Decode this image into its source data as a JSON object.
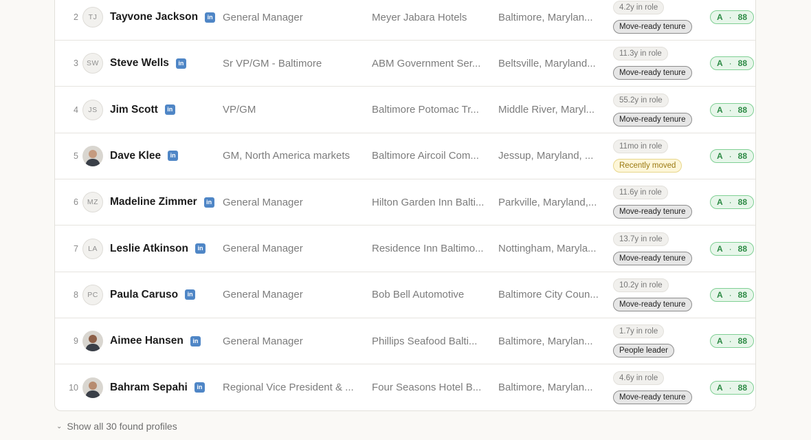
{
  "colors": {
    "linkedin": "#4f86c6",
    "score_green": "#2d8a45",
    "warn_amber": "#9b7a12"
  },
  "rows": [
    {
      "rank": "2",
      "initials": "TJ",
      "photo": false,
      "name": "Tayvone Jackson",
      "title": "General Manager",
      "company": "Meyer Jabara Hotels",
      "location": "Baltimore, Marylan...",
      "tenure": "4.2y in role",
      "status": "Move-ready tenure",
      "status_kind": "neutral",
      "grade": "A",
      "score": "88"
    },
    {
      "rank": "3",
      "initials": "SW",
      "photo": false,
      "name": "Steve Wells",
      "title": "Sr VP/GM - Baltimore",
      "company": "ABM Government Ser...",
      "location": "Beltsville, Maryland...",
      "tenure": "11.3y in role",
      "status": "Move-ready tenure",
      "status_kind": "neutral",
      "grade": "A",
      "score": "88"
    },
    {
      "rank": "4",
      "initials": "JS",
      "photo": false,
      "name": "Jim Scott",
      "title": "VP/GM",
      "company": "Baltimore Potomac Tr...",
      "location": "Middle River, Maryl...",
      "tenure": "55.2y in role",
      "status": "Move-ready tenure",
      "status_kind": "neutral",
      "grade": "A",
      "score": "88"
    },
    {
      "rank": "5",
      "initials": "",
      "photo": true,
      "name": "Dave Klee",
      "title": "GM, North America markets",
      "company": "Baltimore Aircoil Com...",
      "location": "Jessup, Maryland, ...",
      "tenure": "11mo in role",
      "status": "Recently moved",
      "status_kind": "warn",
      "grade": "A",
      "score": "88"
    },
    {
      "rank": "6",
      "initials": "MZ",
      "photo": false,
      "name": "Madeline Zimmer",
      "title": "General Manager",
      "company": "Hilton Garden Inn Balti...",
      "location": "Parkville, Maryland,...",
      "tenure": "11.6y in role",
      "status": "Move-ready tenure",
      "status_kind": "neutral",
      "grade": "A",
      "score": "88"
    },
    {
      "rank": "7",
      "initials": "LA",
      "photo": false,
      "name": "Leslie Atkinson",
      "title": "General Manager",
      "company": "Residence Inn Baltimo...",
      "location": "Nottingham, Maryla...",
      "tenure": "13.7y in role",
      "status": "Move-ready tenure",
      "status_kind": "neutral",
      "grade": "A",
      "score": "88"
    },
    {
      "rank": "8",
      "initials": "PC",
      "photo": false,
      "name": "Paula Caruso",
      "title": "General Manager",
      "company": "Bob Bell Automotive",
      "location": "Baltimore City Coun...",
      "tenure": "10.2y in role",
      "status": "Move-ready tenure",
      "status_kind": "neutral",
      "grade": "A",
      "score": "88"
    },
    {
      "rank": "9",
      "initials": "",
      "photo": true,
      "name": "Aimee Hansen",
      "title": "General Manager",
      "company": "Phillips Seafood Balti...",
      "location": "Baltimore, Marylan...",
      "tenure": "1.7y in role",
      "status": "People leader",
      "status_kind": "neutral",
      "grade": "A",
      "score": "88"
    },
    {
      "rank": "10",
      "initials": "",
      "photo": true,
      "name": "Bahram Sepahi",
      "title": "Regional Vice President & ...",
      "company": "Four Seasons Hotel B...",
      "location": "Baltimore, Marylan...",
      "tenure": "4.6y in role",
      "status": "Move-ready tenure",
      "status_kind": "neutral",
      "grade": "A",
      "score": "88"
    }
  ],
  "linkedin_glyph": "in",
  "score_separator": "·",
  "footer": {
    "show_all_label": "Show all 30 found profiles",
    "chevron_icon": "chevron-down-icon"
  }
}
